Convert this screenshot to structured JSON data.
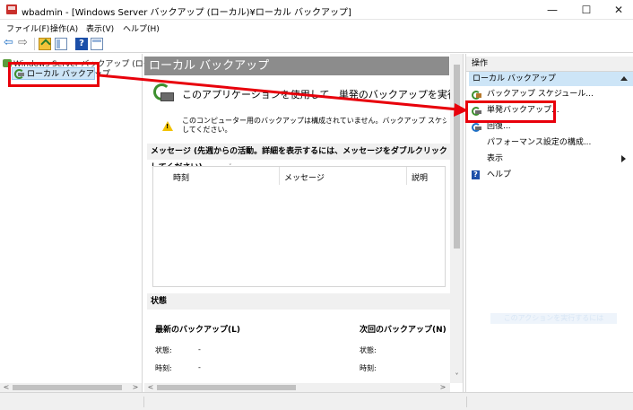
{
  "window": {
    "title": "wbadmin - [Windows Server バックアップ (ローカル)¥ローカル バックアップ]",
    "minimize_label": "—",
    "maximize_label": "☐",
    "close_label": "✕"
  },
  "menubar": {
    "file": "ファイル(F)",
    "action": "操作(A)",
    "view": "表示(V)",
    "help": "ヘルプ(H)"
  },
  "toolbar": {
    "back_label": "⇦",
    "forward_label": "⇨",
    "help_label": "?"
  },
  "tree": {
    "root_label": "Windows Server バックアップ (ローカル)",
    "child_label": "ローカル バックアップ"
  },
  "center": {
    "header": "ローカル バックアップ",
    "intro": "このアプリケーションを使用して、単発のバックアップを実行したり、定",
    "warning_line1": "このコンピューター用のバックアップは構成されていません。バックアップ スケジュール ウィザード",
    "warning_line2": "してください。",
    "warning_mark": "!",
    "messages_title": "メッセージ (先週からの活動。詳細を表示するには、メッセージをダブルクリックしてください)",
    "columns": [
      "時刻",
      "メッセージ",
      "説明"
    ],
    "status_title": "状態",
    "last_backup_title": "最新のバックアップ(L)",
    "next_backup_title": "次回のバックアップ(N)",
    "status_label": "状態:",
    "time_label": "時刻:",
    "dash": "-"
  },
  "actions": {
    "title": "操作",
    "group": "ローカル バックアップ",
    "items": [
      {
        "label": "バックアップ スケジュール..."
      },
      {
        "label": "単発バックアップ..."
      },
      {
        "label": "回復..."
      },
      {
        "label": "パフォーマンス設定の構成..."
      },
      {
        "label": "表示"
      },
      {
        "label": "ヘルプ"
      }
    ],
    "faint_button": "このアクションを実行するには"
  },
  "scrollbar": {
    "left_arrow": "<",
    "right_arrow": ">",
    "down_arrow": "˅"
  },
  "colors": {
    "highlight_red": "#e8000b",
    "selection_blue": "#cde5f7",
    "header_gray": "#8c8c8c"
  }
}
